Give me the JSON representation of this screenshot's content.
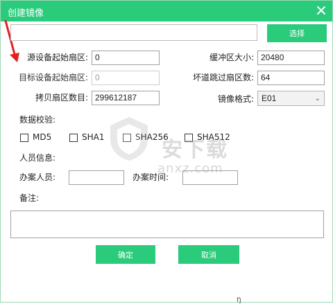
{
  "window": {
    "title": "创建镜像"
  },
  "path": {
    "value": ""
  },
  "select_button": "选择",
  "fields": {
    "source_start": {
      "label": "源设备起始扇区:",
      "value": "0"
    },
    "target_start": {
      "label": "目标设备起始扇区:",
      "value": "0"
    },
    "copy_count": {
      "label": "拷贝扇区数目:",
      "value": "299612187"
    },
    "buffer_size": {
      "label": "缓冲区大小:",
      "value": "20480"
    },
    "skip_bad": {
      "label": "坏道跳过扇区数:",
      "value": "64"
    },
    "image_format": {
      "label": "镜像格式:",
      "value": "E01"
    }
  },
  "checksum": {
    "label": "数据校验:",
    "options": [
      {
        "label": "MD5",
        "checked": false
      },
      {
        "label": "SHA1",
        "checked": false
      },
      {
        "label": "SHA256",
        "checked": false
      },
      {
        "label": "SHA512",
        "checked": false
      }
    ]
  },
  "personnel": {
    "section_label": "人员信息:",
    "officer_label": "办案人员:",
    "officer_value": "",
    "time_label": "办案时间:",
    "time_value": ""
  },
  "notes": {
    "label": "备注:",
    "value": ""
  },
  "buttons": {
    "ok": "确定",
    "cancel": "取消"
  },
  "footer_fragment": "Ŋ",
  "watermark": {
    "text": "安下载",
    "sub": "anxz.com"
  },
  "colors": {
    "accent": "#2bcb7c",
    "annotation_arrow": "#e02020"
  }
}
